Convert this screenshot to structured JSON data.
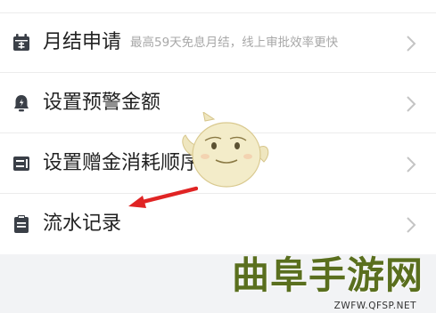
{
  "menu": {
    "items": [
      {
        "label": "月结申请",
        "hint": "最高59天免息月结，线上审批效率更快",
        "icon": "calendar-icon"
      },
      {
        "label": "设置预警金额",
        "hint": "",
        "icon": "alert-bell-icon"
      },
      {
        "label": "设置赠金消耗顺序",
        "hint": "",
        "icon": "list-order-icon"
      },
      {
        "label": "流水记录",
        "hint": "",
        "icon": "clipboard-icon"
      }
    ],
    "chevron_icon": "chevron-right-icon"
  },
  "colors": {
    "label": "#222222",
    "hint": "#a8a8a8",
    "icon": "#3a3f47",
    "arrow": "#e02424",
    "watermark": "#5a6f1e"
  },
  "watermark": {
    "title": "曲阜手游网",
    "url": "ZWFW.QFSP.NET"
  }
}
